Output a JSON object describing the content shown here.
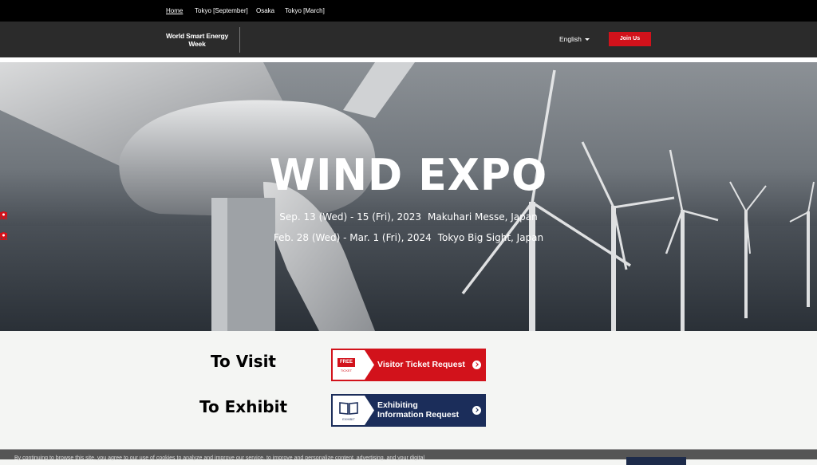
{
  "topnav": {
    "items": [
      "Home",
      "Tokyo [September]",
      "Osaka",
      "Tokyo [March]"
    ]
  },
  "header": {
    "brand_line1": "World Smart Energy",
    "brand_line2": "Week",
    "language": "English",
    "join_label": "Join Us"
  },
  "hero": {
    "title": "WIND EXPO",
    "event1_date": "Sep. 13 (Wed) - 15 (Fri), 2023",
    "event1_venue": "Makuhari Messe, Japan",
    "event2_date": "Feb. 28 (Wed) - Mar. 1 (Fri), 2024",
    "event2_venue": "Tokyo Big Sight, Japan"
  },
  "cta": {
    "visit_label": "To Visit",
    "exhibit_label": "To Exhibit",
    "visitor_badge_top": "FREE",
    "visitor_badge_bottom": "TICKET",
    "visitor_button": "Visitor Ticket Request",
    "exhibit_badge": "EXHIBIT",
    "exhibit_button_line1": "Exhibiting",
    "exhibit_button_line2": "Information Request"
  },
  "cookie": {
    "text": "By continuing to browse this site, you agree to our use of cookies to analyze and improve our service, to improve and personalize content, advertising, and your digital"
  },
  "colors": {
    "accent_red": "#d2121b",
    "exhibit_navy": "#1b2d5a",
    "topbar": "#000000",
    "header": "#2b2b2b"
  },
  "icons": [
    "calendar-icon",
    "map-pin-icon",
    "chevron-right-icon",
    "book-icon",
    "caret-down-icon"
  ]
}
